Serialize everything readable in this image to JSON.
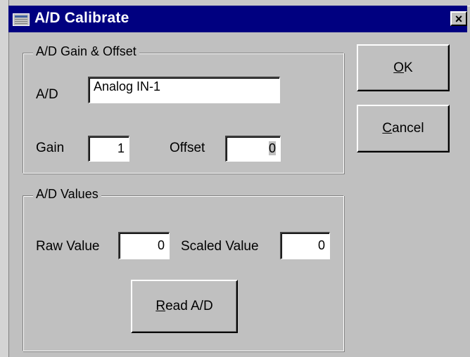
{
  "window": {
    "title": "A/D Calibrate",
    "close_glyph": "×"
  },
  "gain_offset_group": {
    "legend": "A/D Gain & Offset",
    "ad_label": "A/D",
    "ad_value": "Analog IN-1",
    "gain_label": "Gain",
    "gain_value": "1",
    "offset_label": "Offset",
    "offset_value": "0"
  },
  "values_group": {
    "legend": "A/D Values",
    "raw_label": "Raw Value",
    "raw_value": "0",
    "scaled_label": "Scaled Value",
    "scaled_value": "0",
    "read_button": {
      "mnemonic": "R",
      "rest": "ead A/D"
    }
  },
  "buttons": {
    "ok": {
      "mnemonic": "O",
      "rest": "K"
    },
    "cancel": {
      "mnemonic": "C",
      "rest": "ancel"
    }
  },
  "icons": {
    "title_icon": "window-app-icon",
    "close_icon": "close-icon"
  },
  "colors": {
    "titlebar": "#000080",
    "face": "#c0c0c0"
  }
}
